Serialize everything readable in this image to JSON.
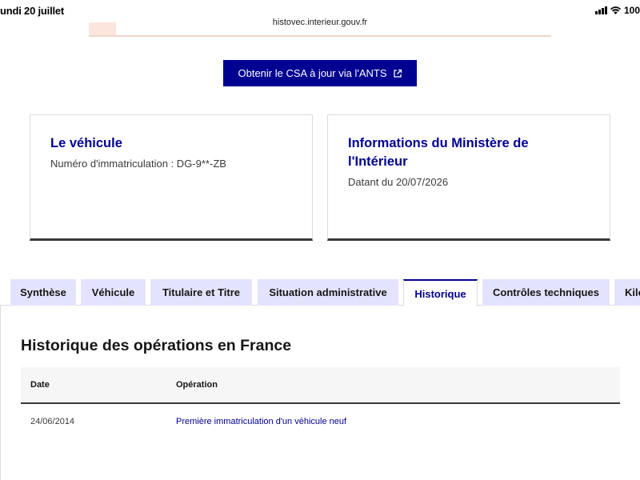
{
  "status_bar": {
    "time": "undi 20 juillet",
    "url": "histovec.interieur.gouv.fr",
    "battery": "100"
  },
  "csa_button": {
    "label": "Obtenir le CSA à jour via l'ANTS",
    "icon": "external-link-icon"
  },
  "cards": [
    {
      "title": "Le véhicule",
      "description": "Numéro d'immatriculation : DG-9**-ZB"
    },
    {
      "title": "Informations du Ministère de l'Intérieur",
      "description": "Datant du 20/07/2026"
    }
  ],
  "tabs": [
    {
      "label": "Synthèse",
      "active": false
    },
    {
      "label": "Véhicule",
      "active": false
    },
    {
      "label": "Titulaire et Titre",
      "active": false
    },
    {
      "label": "Situation administrative",
      "active": false
    },
    {
      "label": "Historique",
      "active": true
    },
    {
      "label": "Contrôles techniques",
      "active": false
    },
    {
      "label": "Kilo",
      "active": false
    }
  ],
  "history": {
    "title": "Historique des opérations en France",
    "columns": [
      "Date",
      "Opération"
    ],
    "rows": [
      {
        "date": "24/06/2014",
        "operation": "Première immatriculation d'un véhicule neuf"
      }
    ]
  },
  "colors": {
    "primary": "#000091",
    "tab_bg": "#e3e3fd",
    "table_header_bg": "#f6f6f6"
  }
}
